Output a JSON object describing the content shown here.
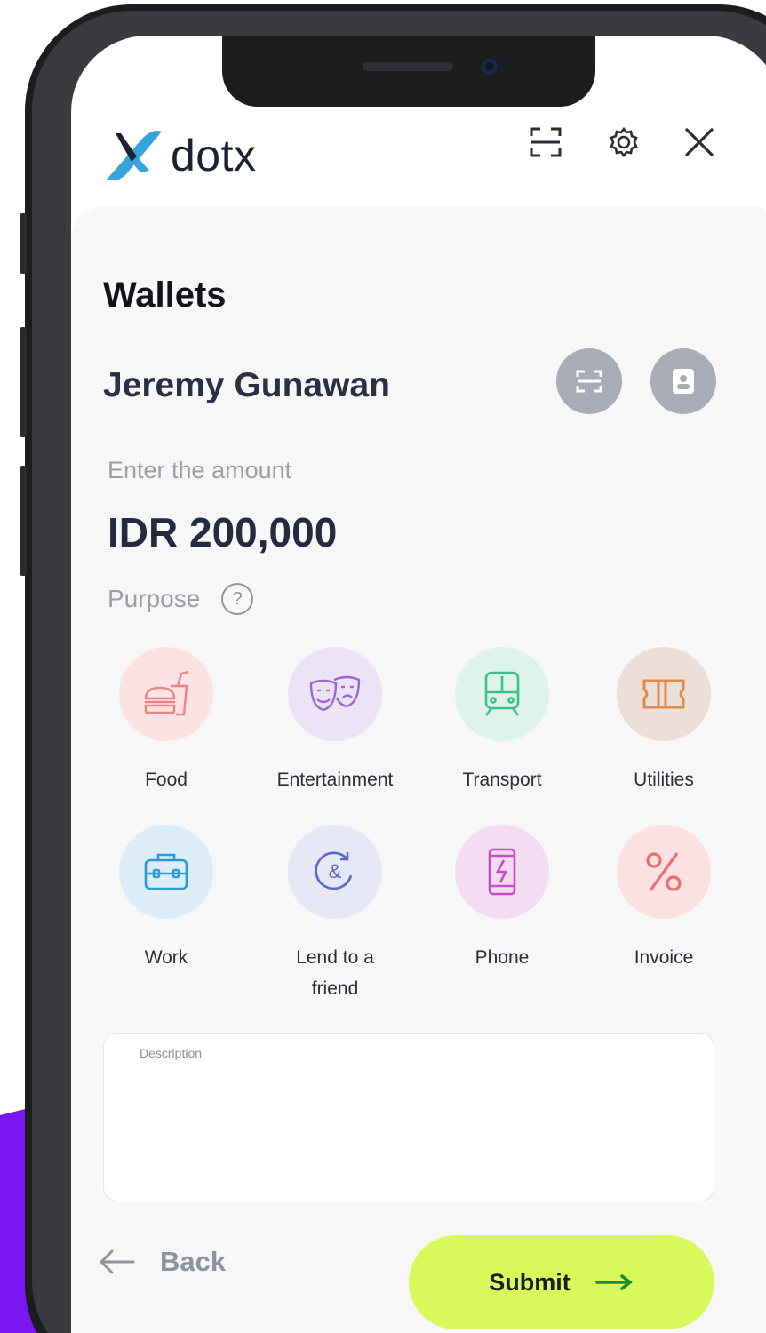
{
  "header": {
    "logo_text": "dotx",
    "icons": [
      "scan-icon",
      "gear-icon",
      "close-icon"
    ]
  },
  "main": {
    "title": "Wallets",
    "recipient_name": "Jeremy Gunawan",
    "recipient_actions": [
      "scan-icon",
      "contact-book-icon"
    ],
    "amount_label": "Enter the amount",
    "amount_value": "IDR 200,000",
    "purpose_label": "Purpose",
    "help_glyph": "?",
    "categories": [
      {
        "label": "Food",
        "icon": "burger-drink-icon",
        "bg": "#fbe3e3",
        "color": "#ec8480"
      },
      {
        "label": "Entertainment",
        "icon": "theater-masks-icon",
        "bg": "#ece3f7",
        "color": "#9a66d6"
      },
      {
        "label": "Transport",
        "icon": "train-icon",
        "bg": "#def4ea",
        "color": "#3fbf86"
      },
      {
        "label": "Utilities",
        "icon": "ticket-icon",
        "bg": "#ecdfd7",
        "color": "#e4894a"
      },
      {
        "label": "Work",
        "icon": "briefcase-icon",
        "bg": "#dcedf8",
        "color": "#2b9bd6"
      },
      {
        "label": "Lend to a friend",
        "icon": "ampersand-icon",
        "bg": "#e6e8f6",
        "color": "#5b68c4"
      },
      {
        "label": "Phone",
        "icon": "phone-icon",
        "bg": "#f4dcf2",
        "color": "#c74bc4"
      },
      {
        "label": "Invoice",
        "icon": "percent-icon",
        "bg": "#fbe1e1",
        "color": "#f06b6b"
      }
    ],
    "description_label": "Description",
    "description_value": ""
  },
  "footer": {
    "back_label": "Back",
    "submit_label": "Submit"
  },
  "colors": {
    "accent_submit": "#d9f95b",
    "logo_blue": "#36a3dd",
    "decor_purple": "#7a16f2"
  }
}
